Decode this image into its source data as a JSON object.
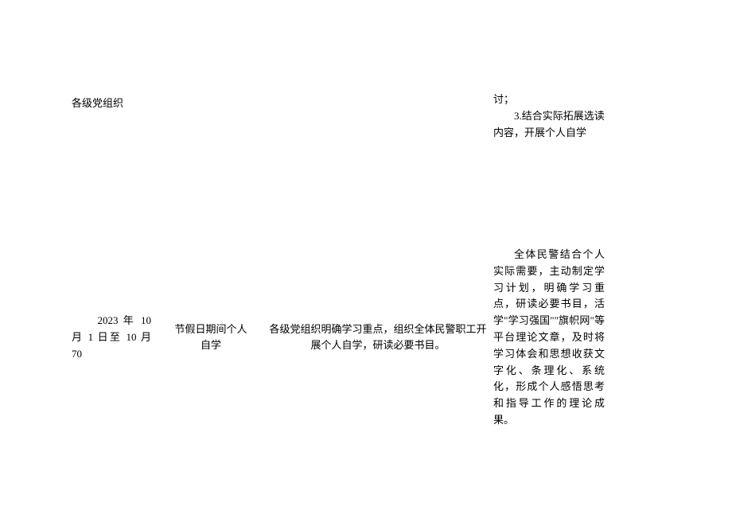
{
  "header": {
    "title": "各级党组织"
  },
  "topRight": {
    "line1": "讨；",
    "line2": "3.结合实际拓展选读内容，开展个人自学"
  },
  "row": {
    "date": "2023 年 10 月 1 日至 10 月 70",
    "period": "节假日期间个人自学",
    "content": "各级党组织明确学习重点，组织全体民警职工开展个人自学，研读必要书目。",
    "detail": "全体民警结合个人实际需要，主动制定学习计划，明确学习重点，研读必要书目，活学\"学习强国\"\"旗帜网\"等平台理论文章，及时将学习体会和思想收获文字化、条理化、系统化，形成个人感悟思考和指导工作的理论成果。"
  }
}
